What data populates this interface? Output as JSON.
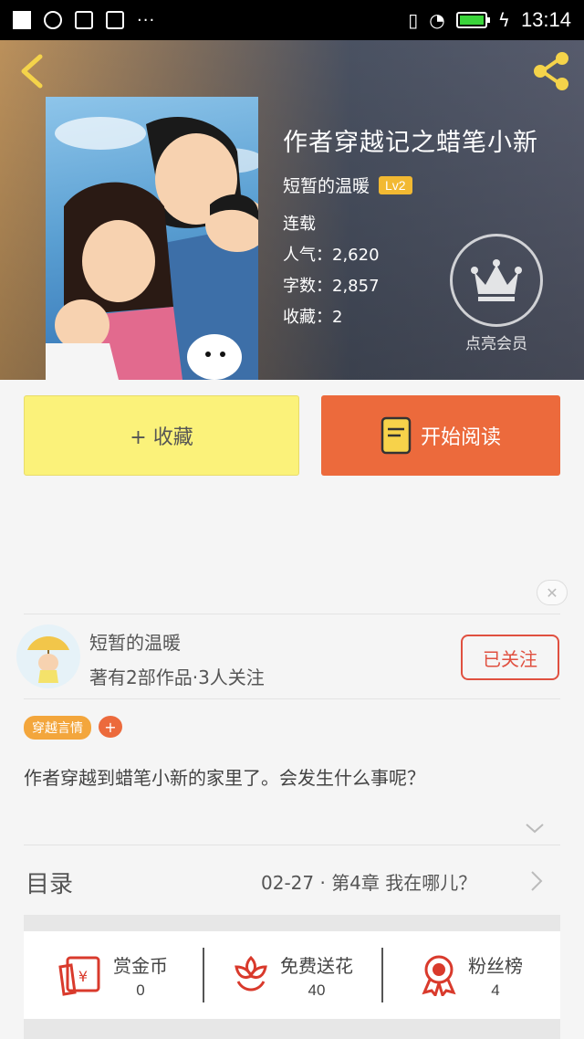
{
  "status_bar": {
    "time": "13:14"
  },
  "book": {
    "title": "作者穿越记之蜡笔小新",
    "author": "短暂的温暖",
    "level": "Lv2",
    "status": "连载",
    "popularity": "人气：2,620",
    "word_count": "字数：2,857",
    "favorites": "收藏：2",
    "vip_label": "点亮会员"
  },
  "actions": {
    "collect_label": "+ 收藏",
    "read_label": "开始阅读"
  },
  "author_card": {
    "name": "短暂的温暖",
    "stats": "著有2部作品·3人关注",
    "follow_label": "已关注"
  },
  "tags": [
    "穿越言情"
  ],
  "tag_add": "+",
  "description": "作者穿越到蜡笔小新的家里了。会发生什么事呢？",
  "toc": {
    "label": "目录",
    "latest": "02-27 · 第4章 我在哪儿？"
  },
  "bottom_stats": [
    {
      "label": "赏金币",
      "value": "0",
      "icon": "red-envelope-icon"
    },
    {
      "label": "免费送花",
      "value": "40",
      "icon": "flower-icon"
    },
    {
      "label": "粉丝榜",
      "value": "4",
      "icon": "medal-icon"
    }
  ],
  "colors": {
    "accent_orange": "#ec6a3c",
    "collect_yellow": "#fbf27a",
    "follow_red": "#e05040",
    "tag_orange": "#f3a63c",
    "level_badge": "#f2b932"
  }
}
